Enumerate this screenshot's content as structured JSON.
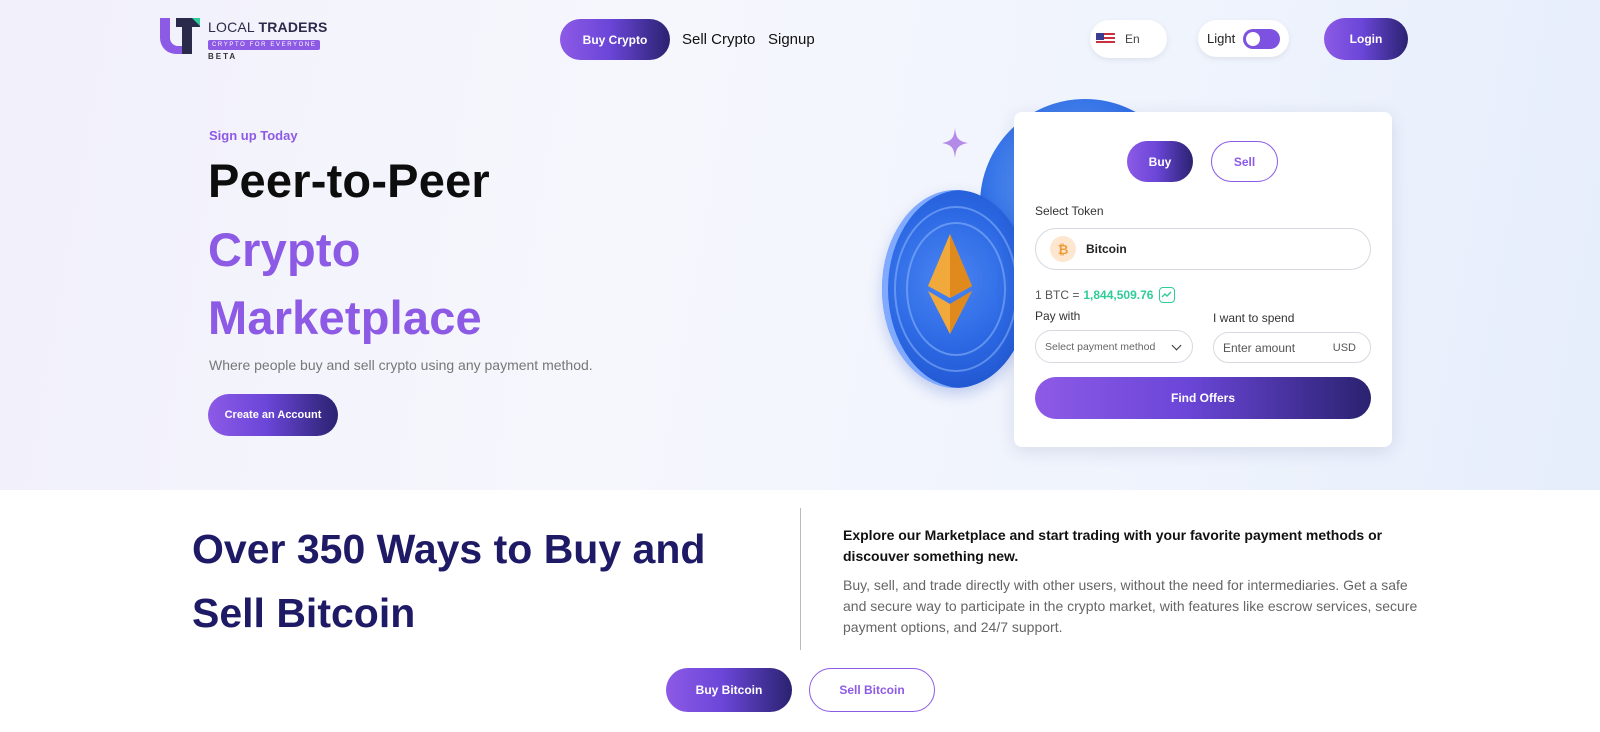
{
  "header": {
    "logo": {
      "name_prefix": "LOCAL ",
      "name_bold": "TRADERS",
      "tagline": "CRYPTO FOR EVERYONE",
      "badge": "BETA"
    },
    "nav": {
      "buy_crypto": "Buy Crypto",
      "sell_crypto": "Sell Crypto",
      "signup": "Signup"
    },
    "language": {
      "code": "En",
      "flag_icon": "us-flag-icon"
    },
    "theme": {
      "label": "Light"
    },
    "login": "Login"
  },
  "hero": {
    "eyebrow": "Sign up Today",
    "title_line1": "Peer-to-Peer",
    "title_line2": "Crypto",
    "title_line3": "Marketplace",
    "subtitle": "Where people buy and sell crypto using any payment method.",
    "cta": "Create an Account"
  },
  "trade_card": {
    "tabs": {
      "buy": "Buy",
      "sell": "Sell"
    },
    "select_token_label": "Select Token",
    "token": "Bitcoin",
    "token_symbol": "₿",
    "rate_prefix": "1 BTC =",
    "rate_value": "1,844,509.76",
    "pay_with_label": "Pay with",
    "pay_placeholder": "Select payment method",
    "spend_label": "I want to spend",
    "amount_placeholder": "Enter amount",
    "currency": "USD",
    "find_offers": "Find Offers"
  },
  "lower": {
    "title": "Over 350 Ways to Buy and Sell Bitcoin",
    "lead": "Explore our Marketplace and start trading with your favorite payment methods or discouver something new.",
    "body": "Buy, sell, and trade directly with other users, without the need for intermediaries. Get a safe and secure way to participate in the crypto market, with features like escrow services, secure payment options, and 24/7 support.",
    "buy_bitcoin": "Buy Bitcoin",
    "sell_bitcoin": "Sell Bitcoin"
  },
  "colors": {
    "accent": "#8d5ae6",
    "dark_navy": "#1f1a66",
    "positive": "#2ecc99"
  }
}
